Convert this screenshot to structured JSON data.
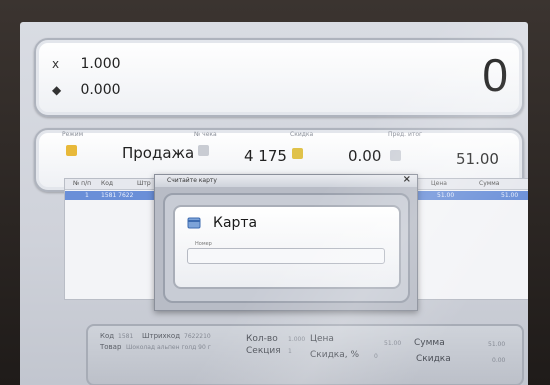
{
  "display": {
    "qty_label": "x",
    "qty_value": "1.000",
    "price_value": "0.000",
    "total": "0"
  },
  "info": {
    "mode_caption": "Режим",
    "mode_value": "Продажа",
    "check_caption": "№ чека",
    "check_value": "4 175",
    "discount_caption": "Скидка",
    "discount_value": "0.00",
    "last_caption": "Пред. итог",
    "last_value": "51.00"
  },
  "table": {
    "headers": [
      "№ п/п",
      "Код",
      "Штр",
      "Цена",
      "Сумма"
    ],
    "selected_row": [
      "1",
      "1581 7622",
      "51.00",
      "51.00"
    ]
  },
  "dialog": {
    "title": "Считайте карту",
    "close": "×",
    "heading": "Карта",
    "number_caption": "Номер"
  },
  "bottom": {
    "code_label": "Код",
    "code_value": "1581",
    "barcode_label": "Штрихкод",
    "barcode_value": "7622210",
    "goods_label": "Товар",
    "goods_value": "Шоколад альпен голд 90 г",
    "qty_label": "Кол-во",
    "qty_value": "1.000",
    "price_label": "Цена",
    "price_value": "51.00",
    "section_label": "Секция",
    "section_value": "1",
    "discpct_label": "Скидка, %",
    "discpct_value": "0",
    "sum_label": "Сумма",
    "sum_value": "51.00",
    "disc_label": "Скидка",
    "disc_value": "0.00"
  }
}
